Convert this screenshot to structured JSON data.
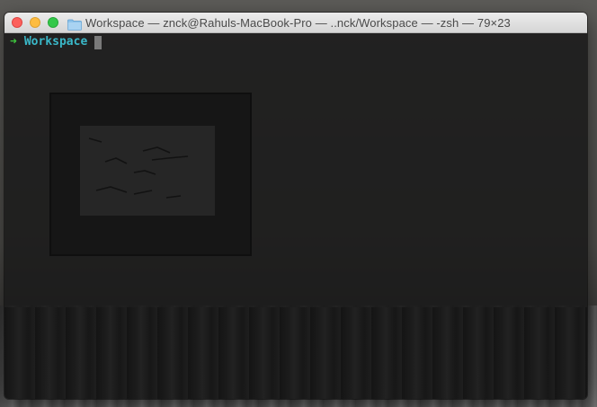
{
  "window": {
    "title": "Workspace — znck@Rahuls-MacBook-Pro — ..nck/Workspace — -zsh — 79×23",
    "title_icon": "folder-icon",
    "controls": [
      "close",
      "minimize",
      "zoom"
    ]
  },
  "terminal": {
    "prompt_symbol": "➜",
    "current_directory": "Workspace",
    "input": ""
  },
  "colors": {
    "prompt_arrow": "#3ec83e",
    "directory": "#3ab8c8",
    "background": "#181818",
    "cursor": "#7a7a7a"
  }
}
